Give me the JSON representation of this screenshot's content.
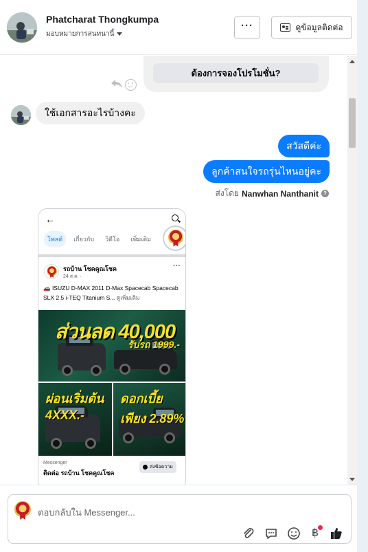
{
  "header": {
    "contact_name": "Phatcharat Thongkumpa",
    "assign_label": "มอบหมายการสนทนานี้",
    "more_label": "···",
    "info_button_label": "ดูข้อมูลติดต่อ"
  },
  "conversation": {
    "promo_card_button": "ต้องการจองโปรโมชั่น?",
    "incoming_message": "ใช้เอกสารอะไรบ้างคะ",
    "outgoing_messages": [
      "สวัสดีค่ะ",
      "ลูกค้าสนใจรถรุ่นไหนอยู่คะ"
    ],
    "sent_by_prefix": "ส่งโดย",
    "sent_by_name": "Nanwhan Nanthanit",
    "sent_by_help": "?"
  },
  "attachment": {
    "tabs": [
      "โพสต์",
      "เกี่ยวกับ",
      "วิดีโอ",
      "เพิ่มเติม"
    ],
    "post_page_name": "รถบ้าน โชคคูณโชค",
    "post_time": "24 ส.ค. ·",
    "post_text": "🚗 ISUZU D-MAX 2011 D-Max Spacecab Spacecab SLX 2.5 i-TEQ Titanium S...",
    "post_see_more": "ดูเพิ่มเติม",
    "promo_main": "ส่วนลด 40,000",
    "promo_sub": "รับรถ 1999.-",
    "promo_left": "ผ่อนเริ่มต้น 4XXX.-",
    "promo_right": "ดอกเบี้ยเพียง 2.89%",
    "footer_label": "Messenger",
    "footer_contact": "ติดต่อ รถบ้าน โชคคูณโชค",
    "footer_button": "ส่งข้อความ"
  },
  "composer": {
    "placeholder": "ตอบกลับใน Messenger..."
  },
  "icons": {
    "header": [
      "chevron-down-icon",
      "more-icon",
      "contact-card-icon"
    ],
    "message_actions": [
      "reply-icon",
      "emoji-icon"
    ],
    "composer_tools": [
      "attachment-icon",
      "quick-reply-icon",
      "emoji-icon",
      "payment-baht-icon",
      "like-icon"
    ]
  },
  "colors": {
    "accent": "#0a7cff",
    "incoming_bubble": "#f0f0f0",
    "notification_dot": "#f02849"
  }
}
